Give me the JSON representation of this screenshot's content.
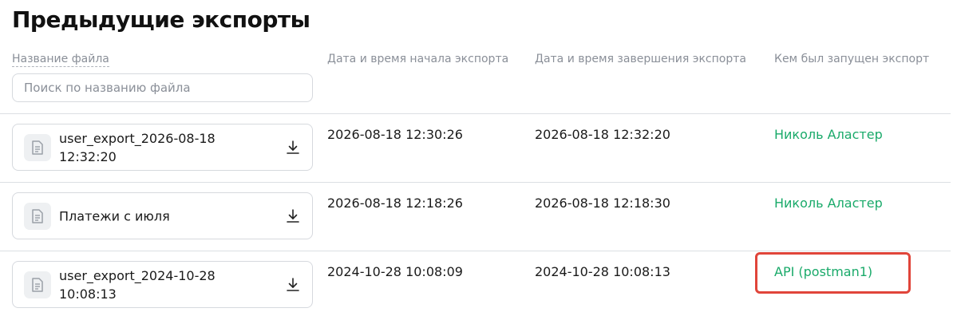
{
  "page": {
    "title": "Предыдущие экспорты"
  },
  "table": {
    "headers": {
      "file_name": "Название файла",
      "start": "Дата и время начала экспорта",
      "end": "Дата и время завершения экспорта",
      "user": "Кем был запущен экспорт"
    },
    "search": {
      "placeholder": "Поиск по названию файла",
      "value": ""
    },
    "rows": [
      {
        "file_name": "user_export_2026-08-18 12:32:20",
        "start": "2026-08-18 12:30:26",
        "end": "2026-08-18 12:32:20",
        "user": "Николь Аластер"
      },
      {
        "file_name": "Платежи с июля",
        "start": "2026-08-18 12:18:26",
        "end": "2026-08-18 12:18:30",
        "user": "Николь Аластер"
      },
      {
        "file_name": "user_export_2024-10-28 10:08:13",
        "start": "2024-10-28 10:08:09",
        "end": "2024-10-28 10:08:13",
        "user": "API (postman1)"
      }
    ]
  },
  "icons": {
    "file": "document-icon",
    "download": "download-icon"
  },
  "colors": {
    "user_link": "#1aaa6a",
    "highlight": "#e0453a",
    "muted_text": "#8a8f98",
    "border": "#d6d9de"
  }
}
